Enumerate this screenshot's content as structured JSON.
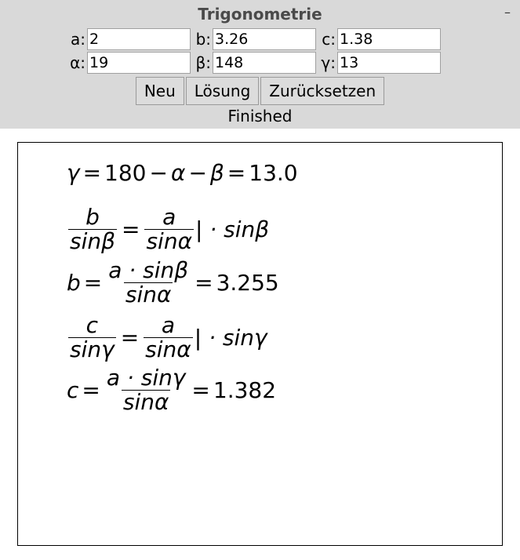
{
  "window": {
    "title": "Trigonometrie",
    "minimize_glyph": "–"
  },
  "fields": {
    "a": {
      "label": "a:",
      "value": "2"
    },
    "b": {
      "label": "b:",
      "value": "3.26"
    },
    "c": {
      "label": "c:",
      "value": "1.38"
    },
    "alpha": {
      "label": "α:",
      "value": "19"
    },
    "beta": {
      "label": "β:",
      "value": "148"
    },
    "gamma": {
      "label": "γ:",
      "value": "13"
    }
  },
  "buttons": {
    "new": "Neu",
    "solve": "Lösung",
    "reset": "Zurücksetzen"
  },
  "status": "Finished",
  "output": {
    "line1": {
      "lhs": "γ",
      "eq": "=",
      "expr_num": "180",
      "minus": "−",
      "alpha": "α",
      "beta": "β",
      "result": "13.0"
    },
    "line2": {
      "num1": "b",
      "den1": "sinβ",
      "num2": "a",
      "den2": "sinα",
      "suffix": "| · sinβ"
    },
    "line3": {
      "lhs": "b",
      "num": "a · sinβ",
      "den": "sinα",
      "result": "3.255"
    },
    "line4": {
      "num1": "c",
      "den1": "sinγ",
      "num2": "a",
      "den2": "sinα",
      "suffix": "| · sinγ"
    },
    "line5": {
      "lhs": "c",
      "num": "a · sinγ",
      "den": "sinα",
      "result": "1.382"
    }
  }
}
